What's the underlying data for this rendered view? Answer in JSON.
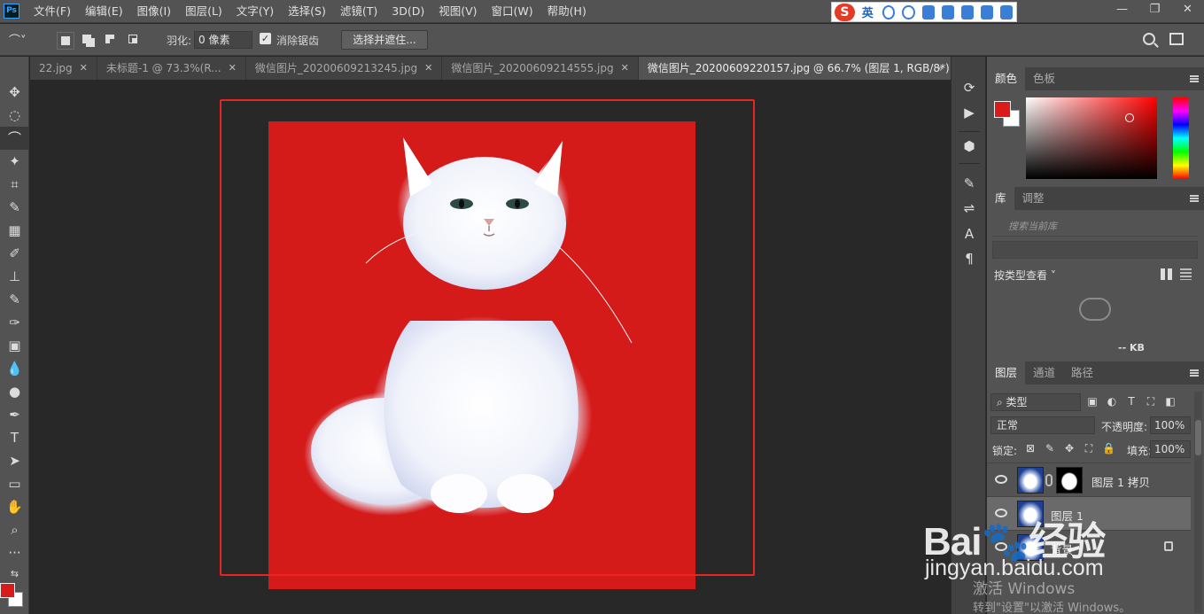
{
  "app": {
    "logo_text": "Ps"
  },
  "menu": [
    "文件(F)",
    "编辑(E)",
    "图像(I)",
    "图层(L)",
    "文字(Y)",
    "选择(S)",
    "滤镜(T)",
    "3D(D)",
    "视图(V)",
    "窗口(W)",
    "帮助(H)"
  ],
  "ime": {
    "logo": "S",
    "lang": "英",
    "tool_icons": [
      "dot-icon",
      "emoji-icon",
      "mic-icon",
      "keyboard-icon",
      "person-icon",
      "shirt-icon",
      "grid-icon"
    ]
  },
  "window_controls": [
    "—",
    "❐",
    "✕"
  ],
  "options": {
    "tool_preset": "⌒˅",
    "feather_label": "羽化:",
    "feather_value": "0 像素",
    "antialias_label": "消除锯齿",
    "select_mask_button": "选择并遮住..."
  },
  "tools": [
    "✥",
    "◌",
    "⌒",
    "✦",
    "⌗",
    "✎",
    "▦",
    "✐",
    "⊥",
    "✎",
    "✑",
    "▣",
    "💧",
    "●",
    "✒",
    "T",
    "➤",
    "▭",
    "✋",
    "⌕",
    "···",
    "⇆"
  ],
  "tabs": [
    {
      "label": "22.jpg",
      "active": false
    },
    {
      "label": "未标题-1 @ 73.3%(R...",
      "active": false
    },
    {
      "label": "微信图片_20200609213245.jpg",
      "active": false
    },
    {
      "label": "微信图片_20200609214555.jpg",
      "active": false
    },
    {
      "label": "微信图片_20200609220157.jpg @ 66.7% (图层 1, RGB/8*) *",
      "active": true
    }
  ],
  "tab_close": "✕",
  "tabs_more": "»",
  "strip_icons": [
    "⟳",
    "▶",
    "⬢",
    "✎",
    "⇌",
    "A",
    "¶"
  ],
  "colors": {
    "foreground": "#d81c1c",
    "background": "#ffffff",
    "tabs": [
      "颜色",
      "色板"
    ]
  },
  "library": {
    "tabs": [
      "库",
      "调整"
    ],
    "search_placeholder": "搜索当前库",
    "view_label": "按类型查看 ˅",
    "size": "-- KB"
  },
  "layers_panel": {
    "tabs": [
      "图层",
      "通道",
      "路径"
    ],
    "filter": "⌕ 类型",
    "filter_icons": [
      "▣",
      "◐",
      "T",
      "⛶",
      "◧"
    ],
    "blend_mode": "正常",
    "opacity_label": "不透明度:",
    "opacity_value": "100%",
    "lock_label": "锁定:",
    "lock_icons": [
      "⊠",
      "✎",
      "✥",
      "⛶",
      "🔒"
    ],
    "fill_label": "填充:",
    "fill_value": "100%",
    "layers": [
      {
        "name": "图层 1 拷贝",
        "selected": false,
        "visible": true,
        "has_mask": true
      },
      {
        "name": "图层 1",
        "selected": true,
        "visible": true,
        "has_mask": false
      },
      {
        "name": "背景",
        "selected": false,
        "visible": true,
        "has_mask": false,
        "locked": true
      }
    ]
  },
  "watermark": {
    "brand": "Bai🐾经验",
    "url": "jingyan.baidu.com"
  },
  "activation": {
    "line1": "激活 Windows",
    "line2": "转到\"设置\"以激活 Windows。"
  }
}
